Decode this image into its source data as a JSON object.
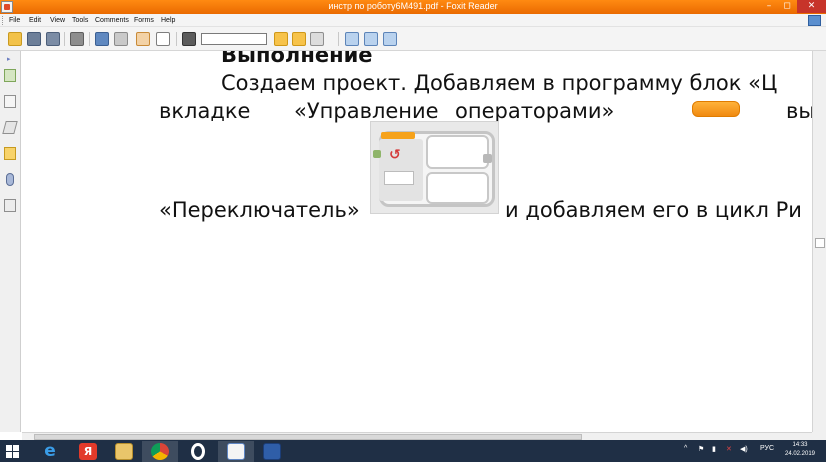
{
  "window": {
    "title": "инстр по роботу6М491.pdf - Foxit Reader",
    "controls": {
      "minimize": "–",
      "maximize": "◻",
      "close": "✕"
    }
  },
  "menu": {
    "items": [
      "File",
      "Edit",
      "View",
      "Tools",
      "Comments",
      "Forms",
      "Help"
    ]
  },
  "toolbar": {
    "find_value": "",
    "icons": [
      "open-icon",
      "save-icon",
      "save-as-icon",
      "print-icon",
      "screen-icon",
      "email-icon",
      "hand-tool-icon",
      "select-text-icon",
      "find-icon",
      "previous-icon",
      "next-icon",
      "page-icon",
      "page-options-icon",
      "zoom-icon",
      "rotate-icon"
    ]
  },
  "sidepanel": {
    "expand_glyph": "▸",
    "icons": [
      "pages-icon",
      "bookmarks-icon",
      "layers-icon",
      "comments-icon",
      "attachments-icon",
      "signature-icon"
    ]
  },
  "document": {
    "heading": "Выполнение",
    "line1": "Создаем проект. Добавляем в программу блок «Ц",
    "line2_left": "вкладке",
    "line2_mid": "«Управление",
    "line2_mid2": "операторами»",
    "line2_end": "вы",
    "line3_left": "«Переключатель»",
    "line3_right": "и добавляем его в цикл Ри"
  },
  "taskbar": {
    "apps": [
      "internet-explorer-icon",
      "yandex-icon",
      "file-explorer-icon",
      "chrome-icon",
      "opera-icon",
      "paint-icon",
      "word-icon"
    ],
    "tray": {
      "chevron": "^",
      "language": "РУС"
    },
    "clock": {
      "time": "14:33",
      "date": "24.02.2019"
    }
  },
  "colors": {
    "titlebar": "#ee7a0a",
    "taskbar": "#1f2f45",
    "accent_orange": "#f6a21a"
  }
}
